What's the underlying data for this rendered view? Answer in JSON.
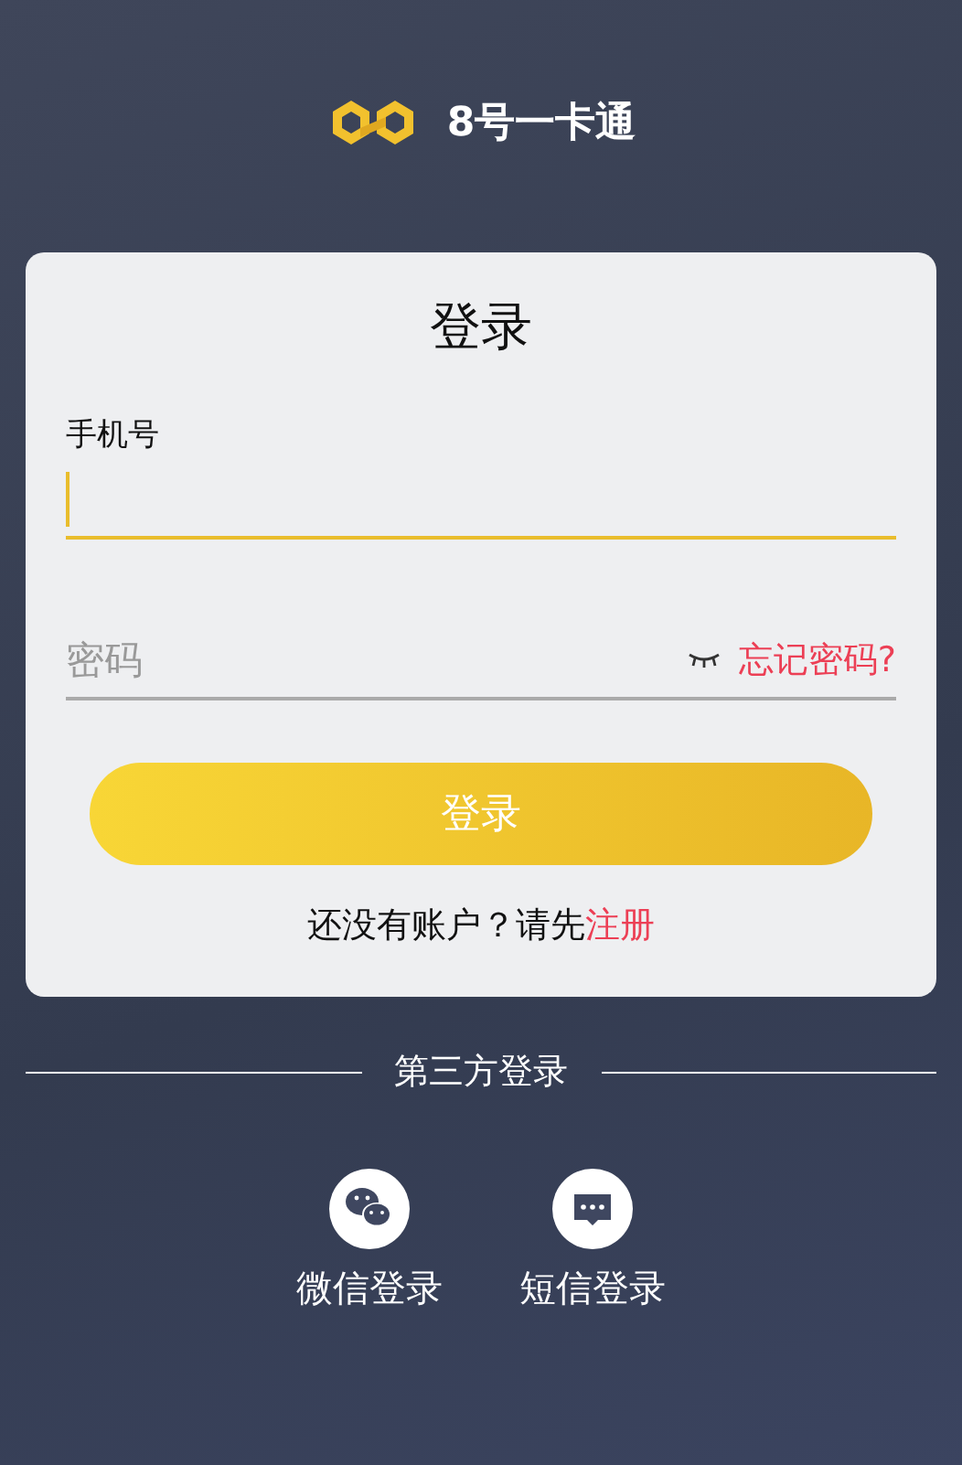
{
  "brand": {
    "name": "8号一卡通"
  },
  "card": {
    "title": "登录",
    "fields": [
      {
        "kind": "labeled",
        "label": "手机号",
        "focused": true
      },
      {
        "kind": "password",
        "placeholder": "密码",
        "focused": false,
        "link": "忘记密码?"
      }
    ],
    "submit": "登录",
    "register": {
      "prompt": "还没有账户？请先",
      "link": "注册"
    }
  },
  "third_party": {
    "title": "第三方登录",
    "options": [
      {
        "kind": "wechat",
        "label": "微信登录"
      },
      {
        "kind": "sms",
        "label": "短信登录"
      }
    ]
  }
}
